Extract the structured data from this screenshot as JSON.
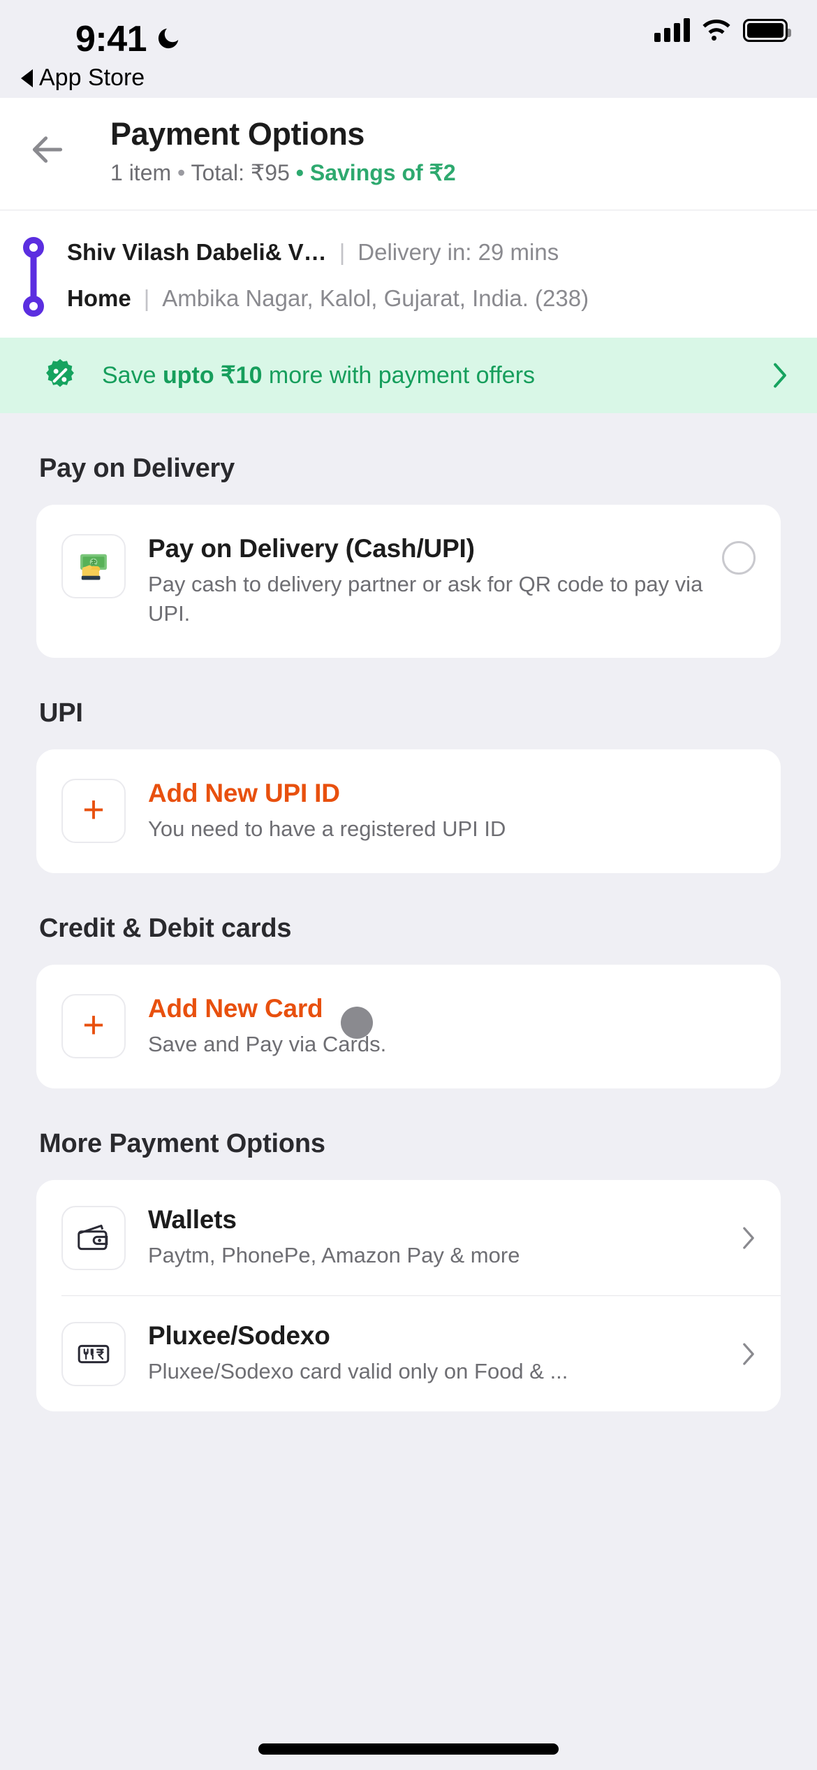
{
  "status_bar": {
    "time": "9:41",
    "dnd_icon": "moon-icon",
    "back_app_label": "App Store",
    "signal_icon": "cellular-signal-icon",
    "wifi_icon": "wifi-icon",
    "battery_icon": "battery-full-icon"
  },
  "header": {
    "back_icon": "arrow-left-icon",
    "title": "Payment Options",
    "subtitle_items": "1 item",
    "subtitle_sep1": "•",
    "subtitle_total": "Total: ₹95",
    "subtitle_sep2": "•",
    "subtitle_savings": "Savings of ₹2"
  },
  "address": {
    "store_name": "Shiv Vilash Dabeli& V…",
    "divider": "|",
    "eta": "Delivery in: 29 mins",
    "label": "Home",
    "divider2": "|",
    "full_address": "Ambika Nagar, Kalol, Gujarat, India. (238)"
  },
  "offer_banner": {
    "badge_icon": "percent-badge-icon",
    "text_prefix": "Save ",
    "text_strong": "upto ₹10",
    "text_suffix": " more with payment offers",
    "chevron_icon": "chevron-right-icon",
    "color": "#169E5C",
    "background": "#D9F7E7"
  },
  "sections": {
    "pay_on_delivery": {
      "title": "Pay on Delivery",
      "row": {
        "icon": "cash-in-hand-icon",
        "title": "Pay on Delivery (Cash/UPI)",
        "subtitle": "Pay cash to delivery partner or ask for QR code to pay via UPI.",
        "radio": "radio-unselected"
      }
    },
    "upi": {
      "title": "UPI",
      "row": {
        "icon": "plus-icon",
        "title": "Add New UPI ID",
        "subtitle": "You need to have a registered UPI ID"
      }
    },
    "cards": {
      "title": "Credit & Debit cards",
      "row": {
        "icon": "plus-icon",
        "title": "Add New Card",
        "subtitle": "Save and Pay via Cards."
      }
    },
    "more": {
      "title": "More Payment Options",
      "rows": [
        {
          "icon": "wallet-icon",
          "title": "Wallets",
          "subtitle": "Paytm, PhonePe, Amazon Pay & more",
          "chevron": "chevron-right-icon"
        },
        {
          "icon": "meal-card-icon",
          "title": "Pluxee/Sodexo",
          "subtitle": "Pluxee/Sodexo card valid only on Food & ...",
          "chevron": "chevron-right-icon"
        }
      ]
    }
  },
  "accent_color": "#E8500E",
  "brand_purple": "#5B2EE0"
}
